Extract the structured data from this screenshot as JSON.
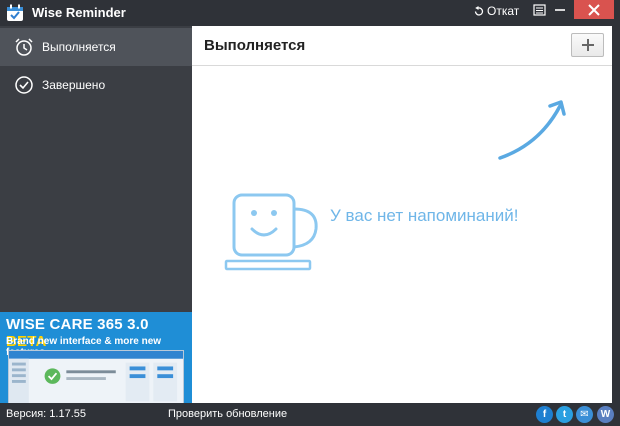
{
  "window": {
    "title": "Wise Reminder",
    "undo_label": "Откат"
  },
  "sidebar": {
    "items": [
      {
        "label": "Выполняется",
        "icon": "alarm-clock-icon",
        "active": true
      },
      {
        "label": "Завершено",
        "icon": "check-circle-icon",
        "active": false
      }
    ],
    "ad": {
      "title_main": "WISE CARE 365 3.0 ",
      "title_beta": "BETA",
      "subtitle": "Brand new interface & more new features"
    }
  },
  "main": {
    "title": "Выполняется",
    "add_icon": "plus-icon",
    "empty_message": "У вас нет напоминаний!"
  },
  "statusbar": {
    "version": "Версия: 1.17.55",
    "update_label": "Проверить обновление",
    "social": [
      "f",
      "t",
      "✉",
      "W"
    ]
  },
  "colors": {
    "dark": "#2f3238",
    "sidebar": "#3b3e44",
    "active_item": "#4f535a",
    "accent_light_blue": "#8cc8f0",
    "close_red": "#d9534f",
    "ad_blue": "#1f8ed6"
  }
}
